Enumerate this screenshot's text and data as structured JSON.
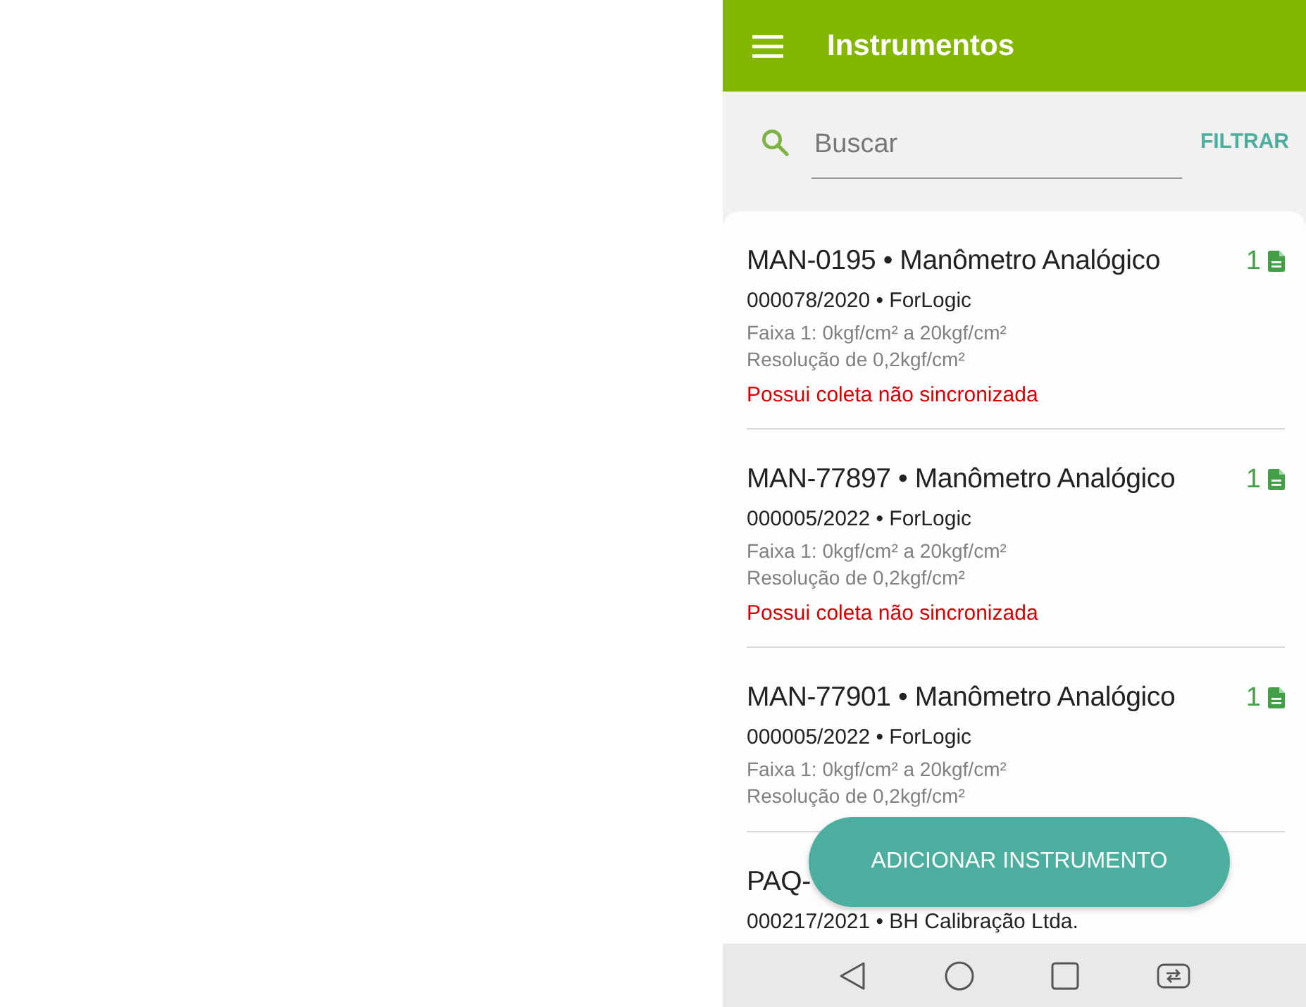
{
  "app_bar": {
    "title": "Instrumentos"
  },
  "search": {
    "placeholder": "Buscar",
    "filter_label": "FILTRAR"
  },
  "instruments": [
    {
      "title": "MAN-0195 • Manômetro Analógico",
      "count": "1",
      "subtitle": "000078/2020 • ForLogic",
      "range": "Faixa 1: 0kgf/cm² a 20kgf/cm²",
      "resolution": "Resolução de 0,2kgf/cm²",
      "warning": "Possui coleta não sincronizada"
    },
    {
      "title": "MAN-77897 • Manômetro Analógico",
      "count": "1",
      "subtitle": "000005/2022 • ForLogic",
      "range": "Faixa 1: 0kgf/cm² a 20kgf/cm²",
      "resolution": "Resolução de 0,2kgf/cm²",
      "warning": "Possui coleta não sincronizada"
    },
    {
      "title": "MAN-77901 • Manômetro Analógico",
      "count": "1",
      "subtitle": "000005/2022 • ForLogic",
      "range": "Faixa 1: 0kgf/cm² a 20kgf/cm²",
      "resolution": "Resolução de 0,2kgf/cm²"
    },
    {
      "title": "PAQ-",
      "subtitle": "000217/2021 • BH Calibração Ltda."
    }
  ],
  "fab": {
    "label": "ADICIONAR INSTRUMENTO"
  }
}
